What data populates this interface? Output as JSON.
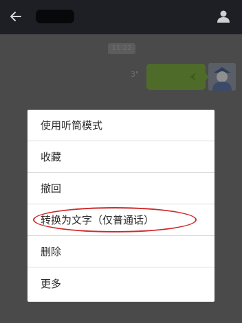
{
  "header": {
    "back_icon": "arrow-left-icon",
    "profile_icon": "person-icon"
  },
  "chat": {
    "timestamp": "11:22",
    "voice_message": {
      "duration": "3\"",
      "icon": "voice-wave-icon"
    }
  },
  "menu": {
    "items": [
      {
        "label": "使用听筒模式"
      },
      {
        "label": "收藏"
      },
      {
        "label": "撤回"
      },
      {
        "label": "转换为文字（仅普通话）"
      },
      {
        "label": "删除"
      },
      {
        "label": "更多"
      }
    ]
  },
  "colors": {
    "topbar": "#1d1f24",
    "overlay": "#4a4a4a",
    "bubble": "#4f6b2a",
    "highlight": "#d12a2a"
  }
}
